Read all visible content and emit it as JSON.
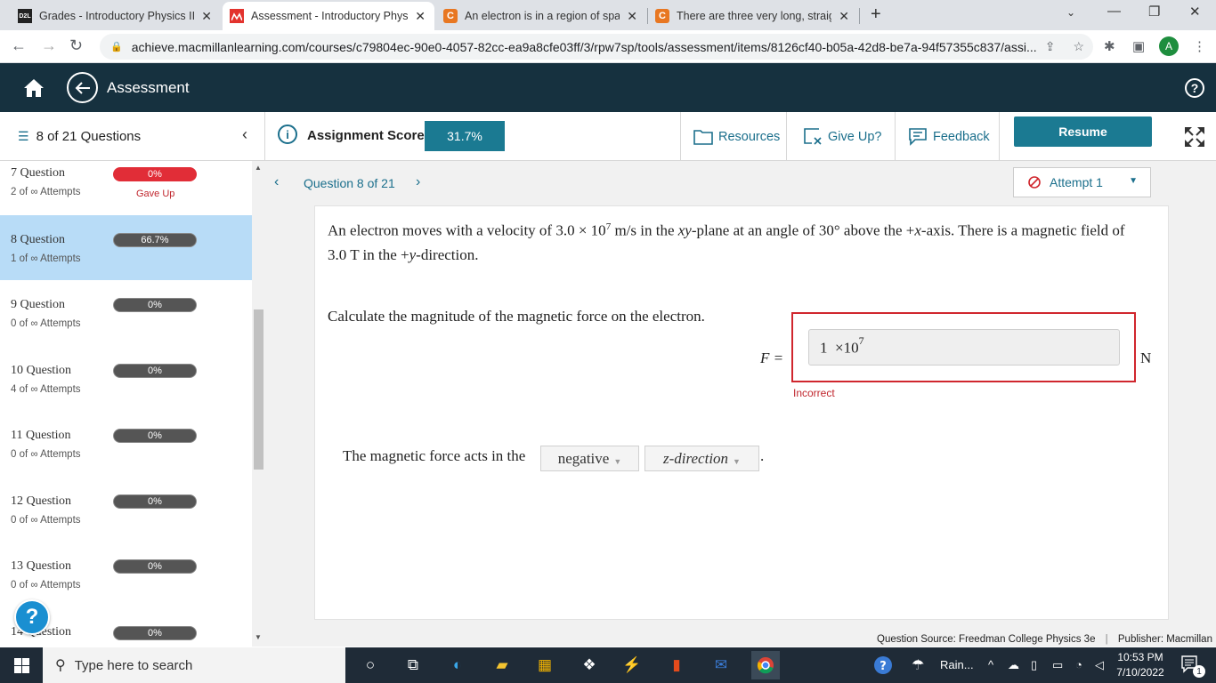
{
  "browser": {
    "tabs": [
      {
        "icon": "d2l-icon",
        "title": "Grades - Introductory Physics II S",
        "active": false
      },
      {
        "icon": "macmillan-icon",
        "title": "Assessment - Introductory Physic",
        "active": true
      },
      {
        "icon": "chegg-icon",
        "title": "An electron is in a region of spac",
        "active": false
      },
      {
        "icon": "chegg-icon",
        "title": "There are three very long, straigh",
        "active": false
      }
    ],
    "url": "achieve.macmillanlearning.com/courses/c79804ec-90e0-4057-82cc-ea9a8cfe03ff/3/rpw7sp/tools/assessment/items/8126cf40-b05a-42d8-be7a-94f57355c837/assi...",
    "profile_initial": "A",
    "favicon_d2l": "D2L",
    "favicon_chegg": "C"
  },
  "app": {
    "title": "Assessment",
    "help": "?"
  },
  "toolbar": {
    "question_count": "8 of 21 Questions",
    "score_label": "Assignment Score:",
    "score_value": "31.7%",
    "resources": "Resources",
    "give_up": "Give Up?",
    "feedback": "Feedback",
    "resume": "Resume"
  },
  "sidebar": {
    "questions": [
      {
        "label": "7 Question",
        "attempts": "2 of ∞ Attempts",
        "score": "0%",
        "status": "Gave Up",
        "score_fraction": 0
      },
      {
        "label": "8 Question",
        "attempts": "1 of ∞ Attempts",
        "score": "66.7%",
        "status": "",
        "score_fraction": 0.667
      },
      {
        "label": "9 Question",
        "attempts": "0 of ∞ Attempts",
        "score": "0%",
        "status": "",
        "score_fraction": 0
      },
      {
        "label": "10 Question",
        "attempts": "4 of ∞ Attempts",
        "score": "0%",
        "status": "",
        "score_fraction": 0
      },
      {
        "label": "11 Question",
        "attempts": "0 of ∞ Attempts",
        "score": "0%",
        "status": "",
        "score_fraction": 0
      },
      {
        "label": "12 Question",
        "attempts": "0 of ∞ Attempts",
        "score": "0%",
        "status": "",
        "score_fraction": 0
      },
      {
        "label": "13 Question",
        "attempts": "0 of ∞ Attempts",
        "score": "0%",
        "status": "",
        "score_fraction": 0
      },
      {
        "label": "14 Question",
        "attempts": "",
        "score": "0%",
        "status": "",
        "score_fraction": 0
      }
    ],
    "help_button": "?"
  },
  "question": {
    "nav_label": "Question 8 of 21",
    "attempt_label": "Attempt 1",
    "problem_text_1": "An electron moves with a velocity of 3.0 × 10",
    "problem_exp": "7",
    "problem_text_2": " m/s in the ",
    "problem_xy": "xy",
    "problem_text_3": "-plane at an angle of 30° above the +",
    "problem_x": "x",
    "problem_text_4": "-axis. There is a magnetic field of 3.0 T in the +",
    "problem_y": "y",
    "problem_text_5": "-direction.",
    "calc_prompt": "Calculate the magnitude of the magnetic force on the electron.",
    "f_label": "F =",
    "answer_mantissa": "1  ×10",
    "answer_exponent": "7",
    "unit": "N",
    "feedback_status": "Incorrect",
    "direction_prompt": "The magnetic force acts in the",
    "direction_sign": "negative",
    "direction_axis": "z-direction",
    "period": "."
  },
  "footer": {
    "source": "Question Source: Freedman College Physics 3e",
    "separator": "|",
    "publisher": "Publisher: Macmillan"
  },
  "taskbar": {
    "search_placeholder": "Type here to search",
    "weather": "Rain...",
    "time": "10:53 PM",
    "date": "7/10/2022",
    "notifications": "1"
  },
  "colors": {
    "header_bg": "#16313f",
    "accent": "#1b7a92",
    "current_question_bg": "#b8dcf7",
    "error": "#d0262d"
  }
}
